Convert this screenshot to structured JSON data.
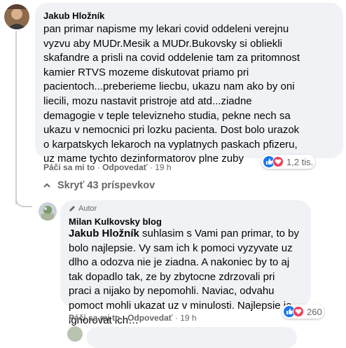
{
  "comment1": {
    "author": "Jakub Hložník",
    "text": "pan primar napisme my lekari covid oddeleni verejnu vyzvu aby MUDr.Mesik a MUDr.Bukovsky si obliekli skafandre a prisli na covid oddelenie tam za pritomnost kamier RTVS mozeme diskutovat priamo pri pacientoch...preberieme liecbu, ukazu nam ako by oni liecili, mozu nastavit pristroje atd atd...ziadne demagogie v teple televizneho studia, pekne nech sa ukazu v nemocnici pri lozku pacienta. Dost bolo urazok o karpatskych lekaroch na vyplatnych paskach pfizeru, uz mame tychto dezinformatorov plne zuby",
    "like_label": "Páči sa mi to",
    "reply_label": "Odpovedať",
    "time": "19 h",
    "reaction_count": "1,2 tis."
  },
  "hide_replies": "Skryť 43 príspevkov",
  "comment2": {
    "badge_label": "Autor",
    "author": "Milan Kulkovsky blog",
    "mention": "Jakub Hložník",
    "text": " suhlasim s Vami pan primar, to by bolo najlepsie. Vy sam ich k pomoci vyzyvate uz dlho a odozva nie je ziadna. A nakoniec by to aj tak dopadlo tak, ze by zbytocne zdrzovali pri praci a nijako by nepomohli. Naviac, odvahu pomoct mohli ukazat uz v minulosti. Najlepsie je ignorovat ich…",
    "like_label": "Páči sa mi to",
    "reply_label": "Odpovedať",
    "time": "19 h",
    "reaction_count": "260"
  },
  "separator": "·",
  "colors": {
    "bubble": "#f0f2f5",
    "like": "#1877f2",
    "love": "#f33e58",
    "meta": "#65676b"
  }
}
